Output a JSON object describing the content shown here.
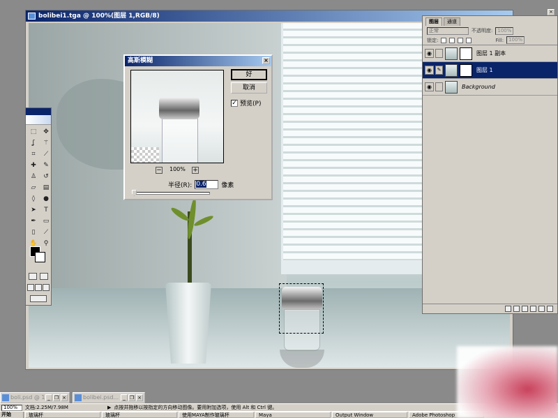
{
  "document": {
    "title": "bolibei1.tga @ 100%(图层 1,RGB/8)"
  },
  "dialog": {
    "title": "高斯模糊",
    "ok_label": "好",
    "cancel_label": "取消",
    "preview_label": "预览(P)",
    "preview_checked": "✓",
    "zoom_out": "−",
    "zoom_in": "+",
    "zoom_level": "100%",
    "radius_label": "半径(R):",
    "radius_value": "0.6",
    "radius_unit": "像素",
    "close_glyph": "×"
  },
  "layers_panel": {
    "tabs": [
      "图层",
      "通道"
    ],
    "blend_mode": "正常",
    "opacity_label": "不透明度:",
    "opacity_value": "100%",
    "lock_label": "锁定:",
    "fill_label": "Fill:",
    "fill_value": "100%",
    "close_glyph": "×",
    "layers": [
      {
        "name": "图层 1 副本",
        "selected": false,
        "has_mask": true
      },
      {
        "name": "图层 1",
        "selected": true,
        "has_mask": true
      },
      {
        "name": "Background",
        "selected": false,
        "has_mask": false
      }
    ]
  },
  "minimized_docs": [
    {
      "title": "boli.psd @ 1..."
    },
    {
      "title": "bolibei.psd..."
    }
  ],
  "status_bar": {
    "zoom": "100%",
    "doc_info": "文档:2.25M/7.98M",
    "hint": "点按并拖移以按指定的方向移动图像。要用附加选项，使用 Alt 和 Ctrl 键。"
  },
  "taskbar": {
    "start": "开始",
    "items": [
      "玻璃杯",
      "玻璃杯",
      "使用MAYA制作玻璃杯",
      "Maya",
      "Output Window",
      "Adobe Photoshop"
    ]
  },
  "colors": {
    "titlebar": "#0a246a",
    "panel": "#d4d0c8",
    "selection": "#0a246a"
  }
}
